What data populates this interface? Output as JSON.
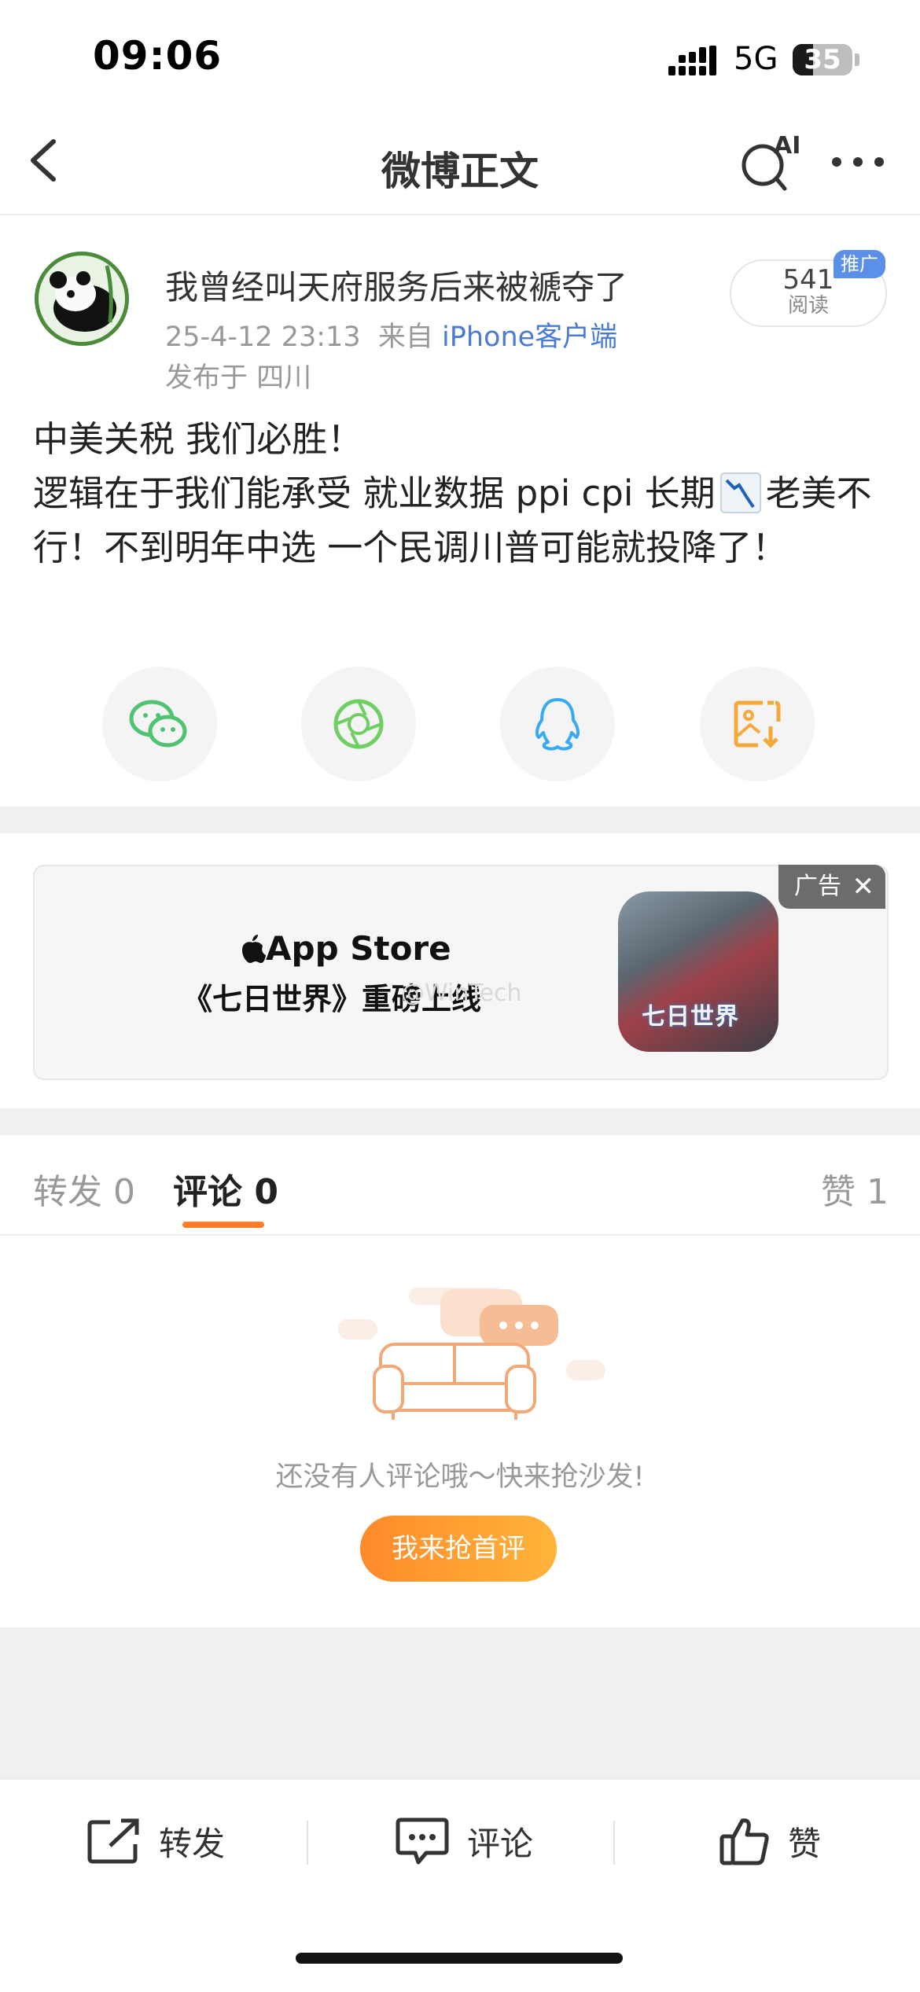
{
  "status_bar": {
    "time": "09:06",
    "network": "5G",
    "battery": "35"
  },
  "nav": {
    "title": "微博正文",
    "back_icon": "chevron-left-icon",
    "ai_search_icon": "ai-search-icon",
    "ai_label": "AI",
    "more_icon": "more-dots-icon"
  },
  "post": {
    "username": "我曾经叫天府服务后来被褫夺了",
    "time": "25-4-12 23:13",
    "source_prefix": "来自",
    "source": "iPhone客户端",
    "location": "发布于 四川",
    "reads": "541",
    "reads_label": "阅读",
    "promo_badge": "推广",
    "body_line1": "中美关税 我们必胜！",
    "body_line2a": "逻辑在于我们能承受 就业数据 ppi cpi 长期",
    "body_line2b": "老美不行！不到明年中选 一个民调川普可能就投降了！"
  },
  "share": [
    {
      "icon": "wechat-icon",
      "color": "#4fc372"
    },
    {
      "icon": "moments-icon",
      "color": "#6fcf63"
    },
    {
      "icon": "qq-icon",
      "color": "#38a9f3"
    },
    {
      "icon": "save-image-icon",
      "color": "#f5a93b"
    }
  ],
  "ad": {
    "store_name": "App Store",
    "headline": "《七日世界》重磅上线",
    "watermark": "@WinTech",
    "label": "广告",
    "close": "✕",
    "game_logo": "七日世界"
  },
  "tabs": {
    "repost": "转发 0",
    "comments": "评论 0",
    "likes": "赞 1"
  },
  "empty_state": {
    "text": "还没有人评论哦～快来抢沙发!",
    "button": "我来抢首评"
  },
  "bottom_bar": {
    "repost": "转发",
    "comment": "评论",
    "like": "赞"
  }
}
